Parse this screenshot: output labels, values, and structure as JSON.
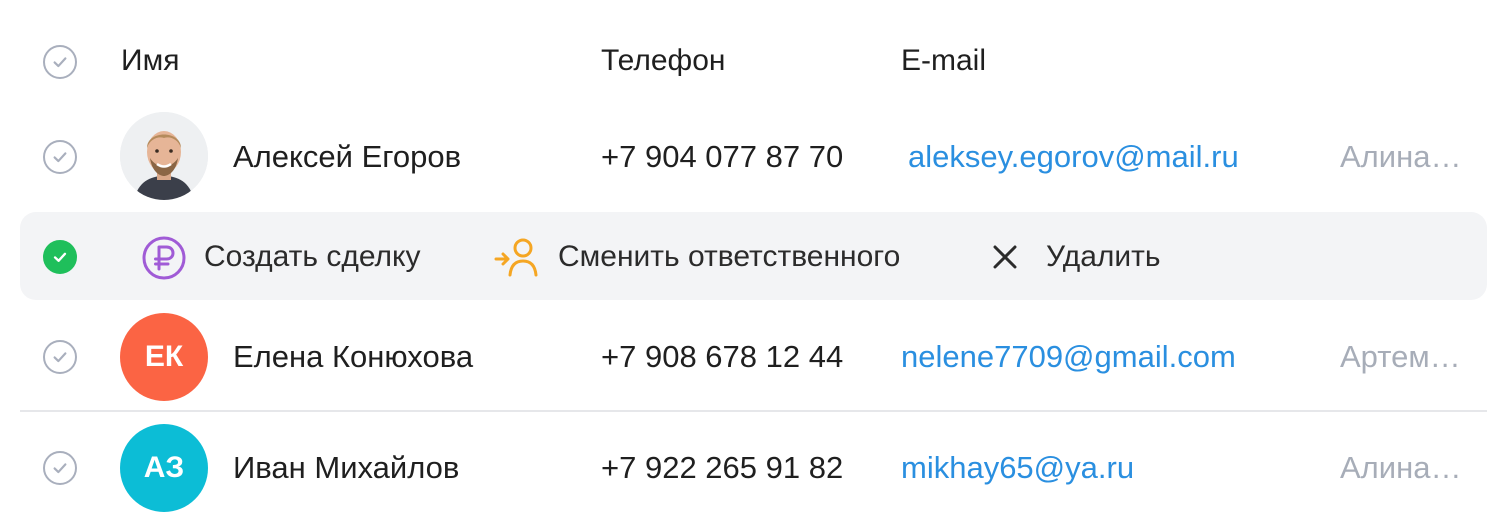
{
  "header": {
    "name_label": "Имя",
    "phone_label": "Телефон",
    "email_label": "E-mail"
  },
  "rows": [
    {
      "name": "Алексей Егоров",
      "phone": "+7 904 077 87 70",
      "email": "aleksey.egorov@mail.ru",
      "responsible": "Алина…",
      "avatar": "photo"
    },
    {
      "name": "Елена Конюхова",
      "phone": "+7 908 678 12 44",
      "email": "nelene7709@gmail.com",
      "responsible": "Артем…",
      "avatar_initials": "ЕК",
      "avatar_color": "#fb6444"
    },
    {
      "name": "Иван Михайлов",
      "phone": "+7 922 265 91 82",
      "email": "mikhay65@ya.ru",
      "responsible": "Алина…",
      "avatar_initials": "АЗ",
      "avatar_color": "#0cbdd6"
    }
  ],
  "actions": {
    "create_deal": "Создать сделку",
    "change_responsible": "Сменить ответственного",
    "delete": "Удалить"
  },
  "colors": {
    "accent_green": "#1fbf5b",
    "link_blue": "#2a8fe0",
    "deal_purple": "#a05bd6",
    "responsible_orange": "#f5a623"
  },
  "icons": [
    "check-icon",
    "ruble-icon",
    "change-user-icon",
    "close-icon"
  ]
}
